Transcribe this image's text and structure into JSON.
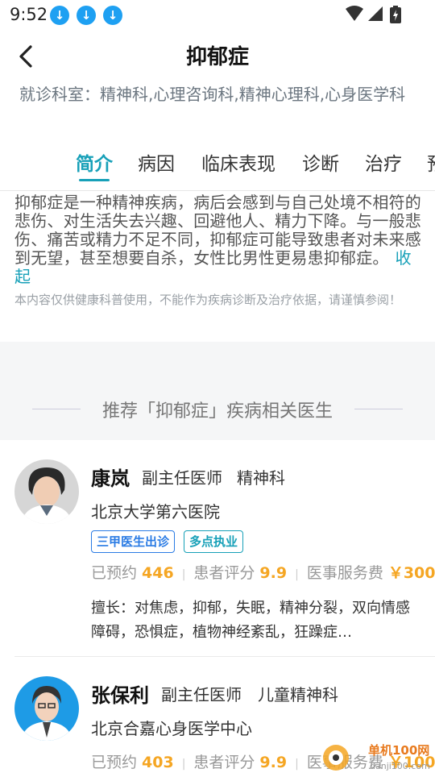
{
  "status": {
    "time": "9:52"
  },
  "header": {
    "title": "抑郁症"
  },
  "dept": {
    "text": "就诊科室：精神科,心理咨询科,精神心理科,心身医学科"
  },
  "tabs": [
    {
      "label": "简介",
      "active": true
    },
    {
      "label": "病因"
    },
    {
      "label": "临床表现"
    },
    {
      "label": "诊断"
    },
    {
      "label": "治疗"
    },
    {
      "label": "预"
    }
  ],
  "intro": {
    "text": "抑郁症是一种精神疾病，病后会感到与自己处境不相符的悲伤、对生活失去兴趣、回避他人、精力下降。与一般悲伤、痛苦或精力不足不同，抑郁症可能导致患者对未来感到无望，甚至想要自杀，女性比男性更易患抑郁症。",
    "collapse": "收起",
    "disclaimer": "本内容仅供健康科普使用，不能作为疾病诊断及治疗依据，请谨慎参阅！"
  },
  "recommend": {
    "title": "推荐「抑郁症」疾病相关医生"
  },
  "doctors": [
    {
      "name": "康岚",
      "title": "副主任医师",
      "dept": "精神科",
      "hospital": "北京大学第六医院",
      "tags": [
        "三甲医生出诊",
        "多点执业"
      ],
      "booked_label": "已预约",
      "booked": "446",
      "rating_label": "患者评分",
      "rating": "9.9",
      "fee_label": "医事服务费",
      "fee": "￥300",
      "skill": "擅长：对焦虑，抑郁，失眠，精神分裂，双向情感障碍，恐惧症，植物神经紊乱，狂躁症…"
    },
    {
      "name": "张保利",
      "title": "副主任医师",
      "dept": "儿童精神科",
      "hospital": "北京合嘉心身医学中心",
      "booked_label": "已预约",
      "booked": "403",
      "rating_label": "患者评分",
      "rating": "9.9",
      "fee_label": "医事服务费",
      "fee": "￥100"
    }
  ],
  "watermark": {
    "text": "单机100网",
    "url": "danji100.com"
  },
  "colors": {
    "accent": "#17a0b8",
    "orange": "#f5a623",
    "blue_tag": "#2a7be4"
  }
}
